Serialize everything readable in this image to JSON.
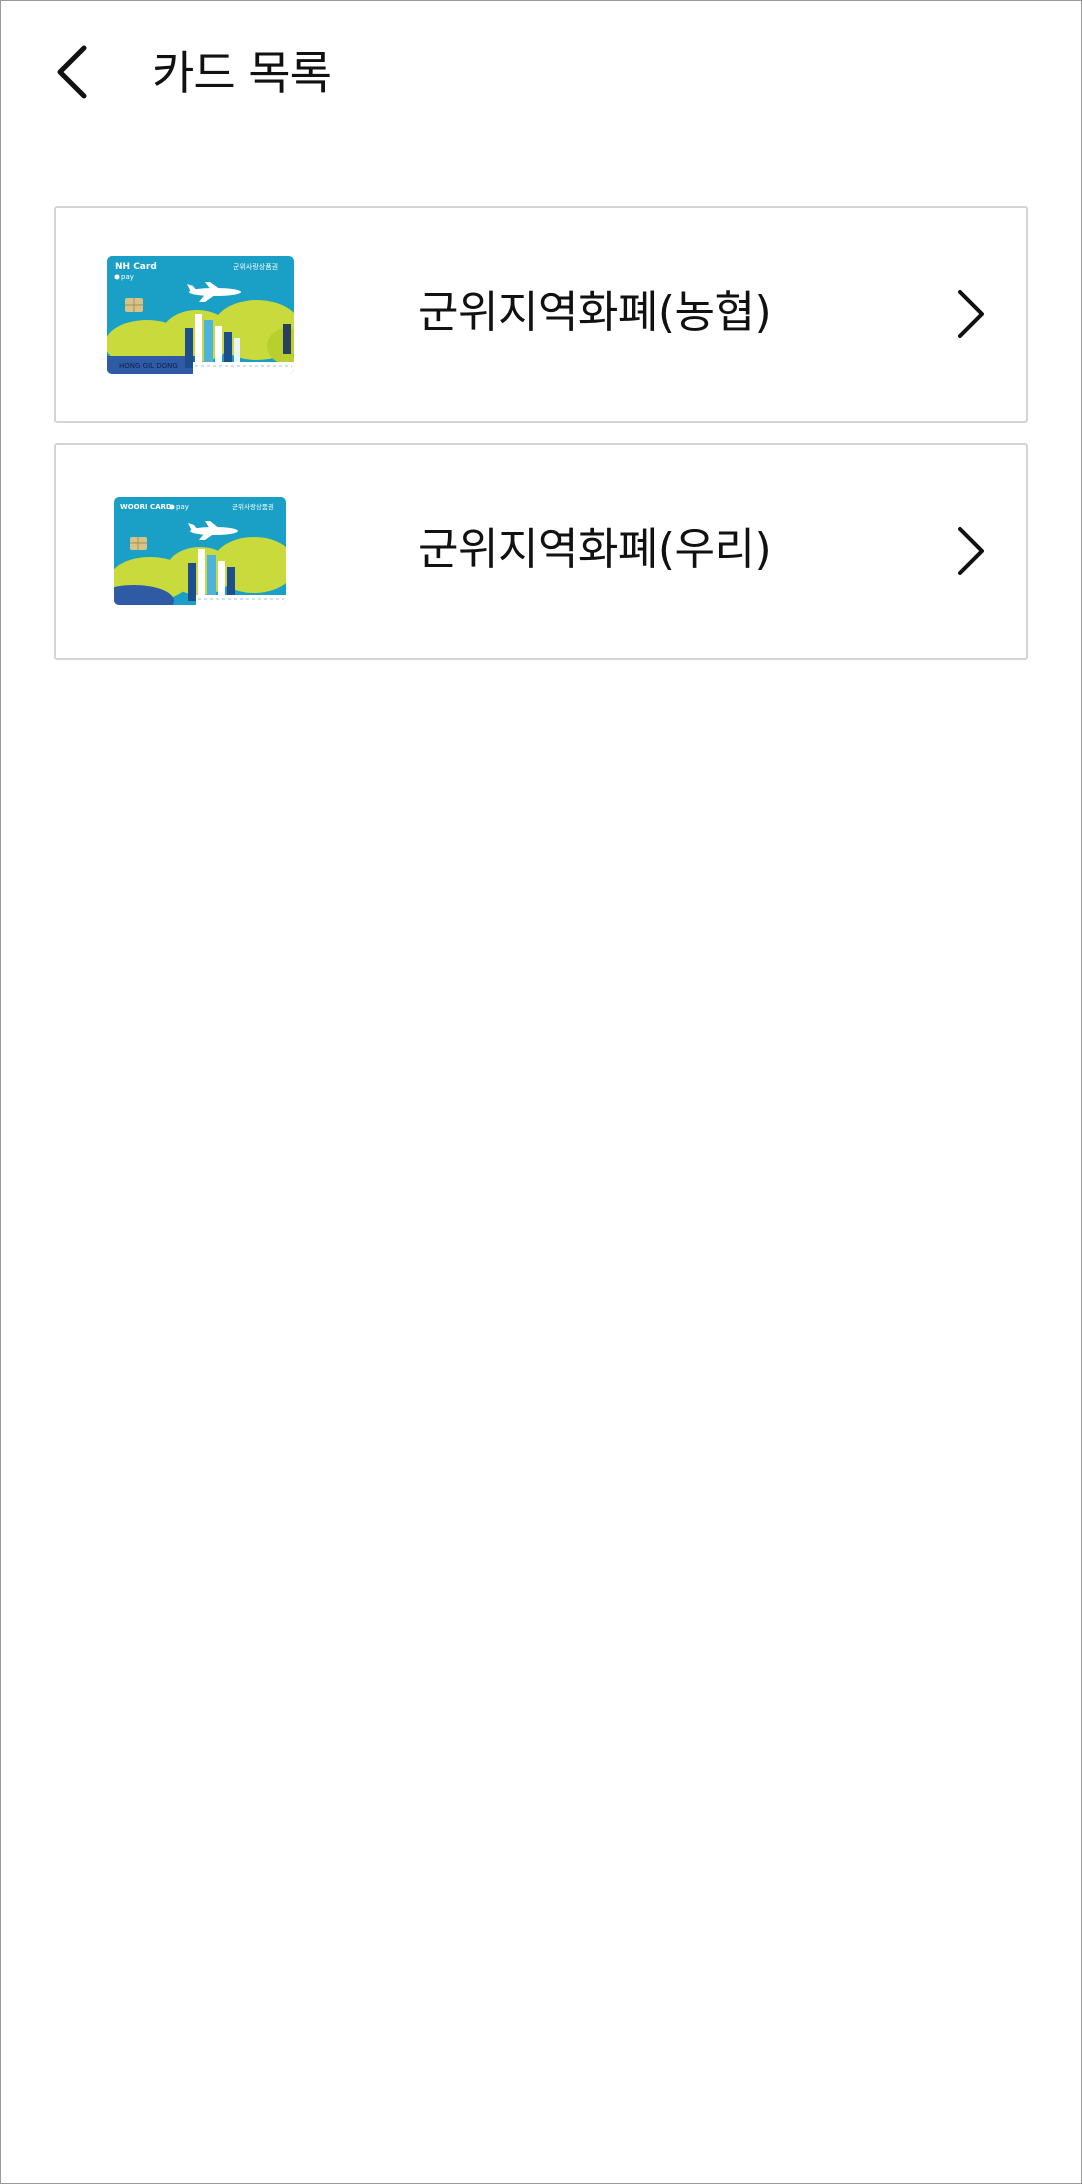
{
  "header": {
    "title": "카드 목록",
    "back_icon": "chevron-left-icon"
  },
  "cards": [
    {
      "name": "군위지역화폐(농협)",
      "thumbnail": {
        "brand": "NH Card",
        "brand_sub": "pay",
        "issuer_text": "군위사랑상품권",
        "holder": "HONG GIL DONG"
      },
      "arrow_icon": "chevron-right-icon"
    },
    {
      "name": "군위지역화폐(우리)",
      "thumbnail": {
        "brand": "WOORI CARD",
        "brand_sub": "pay",
        "issuer_text": "군위사랑상품권"
      },
      "arrow_icon": "chevron-right-icon"
    }
  ],
  "colors": {
    "card_teal": "#1aa0c7",
    "card_lime": "#c8da3c",
    "card_navy": "#2f5aa6",
    "border": "#d4d4d4"
  }
}
